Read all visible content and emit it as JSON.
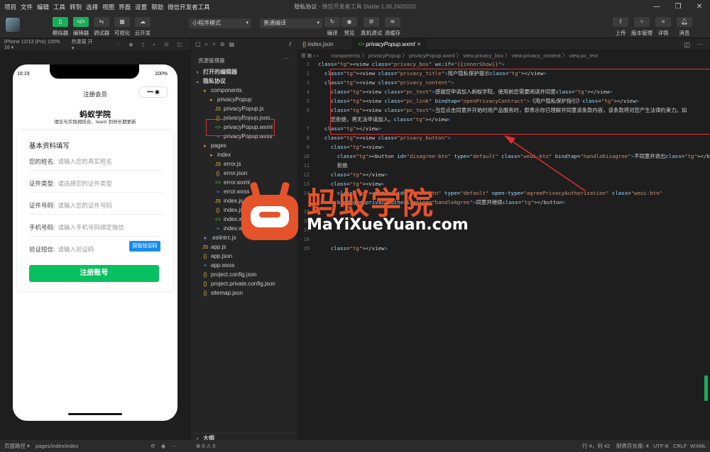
{
  "menu": [
    "项目",
    "文件",
    "编辑",
    "工具",
    "转到",
    "选择",
    "视图",
    "界面",
    "设置",
    "帮助",
    "微信开发者工具"
  ],
  "window": {
    "title": "隐私协议",
    "subtitle": "- 微信开发者工具 Stable 1.06.2405020"
  },
  "toolbar": {
    "simulator": "模拟器",
    "editor": "编辑器",
    "debugger": "调试器",
    "visual": "可视化",
    "cloud": "云开发",
    "mode_select": "小程序模式",
    "compile_select": "普通编译",
    "compile": "编译",
    "preview": "预览",
    "real_debug": "真机调试",
    "clear_cache": "清缓存",
    "upload": "上传",
    "version": "版本管理",
    "details": "详情",
    "messages": "消息"
  },
  "sim_bar": {
    "device": "iPhone 12/13 (Pro) 100% 16 ▾",
    "hotreload": "热重载 开 ▾"
  },
  "phone": {
    "time": "16:19",
    "battery": "100%",
    "nav_title": "注册会员",
    "brand": "蚂蚁学院",
    "slogan": "理论与实践相结合、teach 到你长期更新",
    "section_title": "基本资料填写",
    "fields": [
      {
        "label": "您的姓名:",
        "placeholder": "请输入您的真实姓名"
      },
      {
        "label": "证件类型:",
        "placeholder": "请选择您的证件类型"
      },
      {
        "label": "证件号码:",
        "placeholder": "请输入您的证件号码"
      },
      {
        "label": "手机号码:",
        "placeholder": "请输入手机号码绑定微信"
      },
      {
        "label": "验证短信:",
        "placeholder": "请输入验证码"
      }
    ],
    "get_code": "获取验证码",
    "submit": "注册账号"
  },
  "explorer": {
    "title": "资源管理器",
    "open_editors": "打开的编辑器",
    "project": "隐私协议",
    "items": [
      {
        "name": "components",
        "type": "fold",
        "indent": 1
      },
      {
        "name": "privacyPopup",
        "type": "fold",
        "indent": 2
      },
      {
        "name": "privacyPopup.js",
        "type": "js",
        "indent": 3
      },
      {
        "name": "privacyPopup.json",
        "type": "json",
        "indent": 3
      },
      {
        "name": "privacyPopup.wxml",
        "type": "wxml",
        "indent": 3
      },
      {
        "name": "privacyPopup.wxss",
        "type": "wxss",
        "indent": 3
      },
      {
        "name": "pages",
        "type": "fold",
        "indent": 1
      },
      {
        "name": "index",
        "type": "fold",
        "indent": 2
      },
      {
        "name": "error.js",
        "type": "js",
        "indent": 3
      },
      {
        "name": "error.json",
        "type": "json",
        "indent": 3
      },
      {
        "name": "error.wxml",
        "type": "wxml",
        "indent": 3
      },
      {
        "name": "error.wxss",
        "type": "wxss",
        "indent": 3
      },
      {
        "name": "index.js",
        "type": "js",
        "indent": 3
      },
      {
        "name": "index.json",
        "type": "json",
        "indent": 3
      },
      {
        "name": "index.wxml",
        "type": "wxml",
        "indent": 3
      },
      {
        "name": "index.wxss",
        "type": "wxss",
        "indent": 3
      },
      {
        "name": ".eslintrc.js",
        "type": "eslint",
        "indent": 1
      },
      {
        "name": "app.js",
        "type": "js",
        "indent": 1
      },
      {
        "name": "app.json",
        "type": "json",
        "indent": 1
      },
      {
        "name": "app.wxss",
        "type": "wxss",
        "indent": 1
      },
      {
        "name": "project.config.json",
        "type": "json",
        "indent": 1
      },
      {
        "name": "project.private.config.json",
        "type": "json",
        "indent": 1
      },
      {
        "name": "sitemap.json",
        "type": "json",
        "indent": 1
      }
    ],
    "outline": "大纲"
  },
  "tabs": [
    {
      "label": "index.json",
      "active": false
    },
    {
      "label": "privacyPopup.wxml",
      "active": true
    }
  ],
  "breadcrumb": "components 〉 privacyPopup 〉 privacyPopup.wxml 〉 view.privacy_box 〉 view.privacy_content 〉 view.pc_text",
  "code_lines": [
    "<view class=\"privacy_box\" wx:if=\"{{innerShow}}\">",
    "  <view class=\"privacy_title\">用户隐私保护提示</view>",
    "  <view class=\"privacy_content\">",
    "    <view class=\"pc_text\">感谢您申请加入蚂蚁学院，使用前您需要阅读并同意</view>",
    "    <view class=\"pc_link\" bindtap=\"openPrivacyContract\">《用户隐私保护指引》</view>",
    "    <view class=\"pc_text\">当您点击同意并开始时用产品服务时，即表示你已理解并同意该条款内容，该条款将对您产生法律约束力。如",
    "    您拒绝，将无法申请加入。</view>",
    "  </view>",
    "  <view class=\"privacy_button\">",
    "    <view>",
    "      <button id=\"disagree-btn\" type=\"default\" class=\"weui-btn\" bindtap=\"handleDisagree\">不同意并退出</button>",
    "      拒绝",
    "    </view>",
    "    <view>",
    "      <button id=\"agree-btn\" type=\"default\" open-type=\"agreePrivacyAuthorization\" class=\"weui-btn\"",
    "      bindagreeprivacyauthorization=\"handleAgree\">同意并继续</button>",
    "",
    "",
    "",
    "",
    "    </view>"
  ],
  "line_numbers": [
    "1",
    "2",
    "3",
    "4",
    "5",
    "6",
    "",
    "7",
    "8",
    "9",
    "10",
    "11",
    "12",
    "13",
    "14",
    "",
    "15",
    "16",
    "17",
    "18",
    "19"
  ],
  "watermark": {
    "cn": "蚂蚁学院",
    "en": "MaYiXueYuan.com"
  },
  "status": {
    "path_label": "页面路径 ▾",
    "path": "pages/index/index",
    "problems": "⊗ 0 ⚠ 0",
    "position": "行 4，列 42",
    "tab_size": "制表符长度: 4",
    "encoding": "UTF-8",
    "eol": "CRLF",
    "lang": "WXML"
  },
  "colors": {
    "accent_green": "#07c160",
    "code_tag": "#569cd6",
    "code_attr": "#9cdcfe",
    "code_string": "#ce9178",
    "highlight_red": "#e03030",
    "watermark_orange": "#e5532b"
  }
}
